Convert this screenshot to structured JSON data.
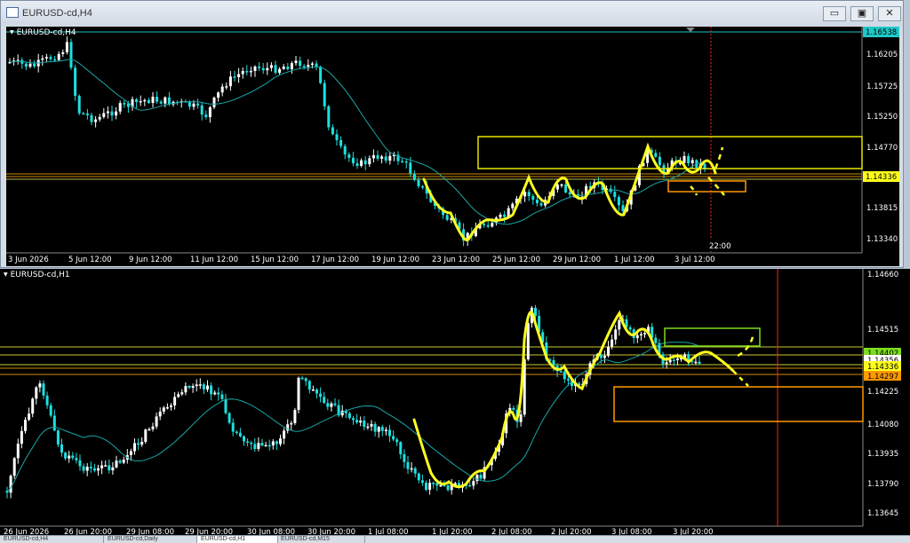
{
  "window": {
    "title": "EURUSD-cd,H4",
    "minimize": "▭",
    "restore": "▣",
    "close": "✕"
  },
  "top_chart": {
    "label": "EURUSD-cd,H4",
    "price_levels": [
      "1.16538",
      "1.16205",
      "1.15725",
      "1.15250",
      "1.14770",
      "1.14336",
      "1.13815",
      "1.13340"
    ],
    "current_price": "1.14336",
    "date_labels": [
      "3 Jun 2026",
      "5 Jun 12:00",
      "9 Jun 12:00",
      "11 Jun 12:00",
      "15 Jun 12:00",
      "17 Jun 12:00",
      "19 Jun 12:00",
      "23 Jun 12:00",
      "25 Jun 12:00",
      "29 Jun 12:00",
      "1 Jul 12:00",
      "3 Jul 12:00"
    ],
    "time_marker": "22:00"
  },
  "bottom_chart": {
    "label": "EURUSD-cd,H1",
    "price_levels": [
      "1.14660",
      "1.14515",
      "1.14402",
      "1.14356",
      "1.14336",
      "1.14297",
      "1.14225",
      "1.14080",
      "1.13935",
      "1.13790",
      "1.13645"
    ],
    "date_labels": [
      "26 Jun 2026",
      "26 Jun 20:00",
      "29 Jun 08:00",
      "29 Jun 20:00",
      "30 Jun 08:00",
      "30 Jun 20:00",
      "1 Jul 08:00",
      "1 Jul 20:00",
      "2 Jul 08:00",
      "2 Jul 20:00",
      "3 Jul 08:00",
      "3 Jul 20:00"
    ]
  },
  "colors": {
    "bull": "#ffffff",
    "bear": "#1ee0e0",
    "ma": "#1aa6a6",
    "drawing": "#ffff1e",
    "zone_yellow": "#e6e600",
    "zone_green": "#7ddc1e",
    "zone_orange": "#ff9900",
    "level_orange": "#d08a00",
    "vline": "#ff2020"
  },
  "tabs": [
    "EURUSD-cd,H4",
    "EURUSD-cd,Daily",
    "EURUSD-cd,H1",
    "EURUSD-cd,M15"
  ]
}
